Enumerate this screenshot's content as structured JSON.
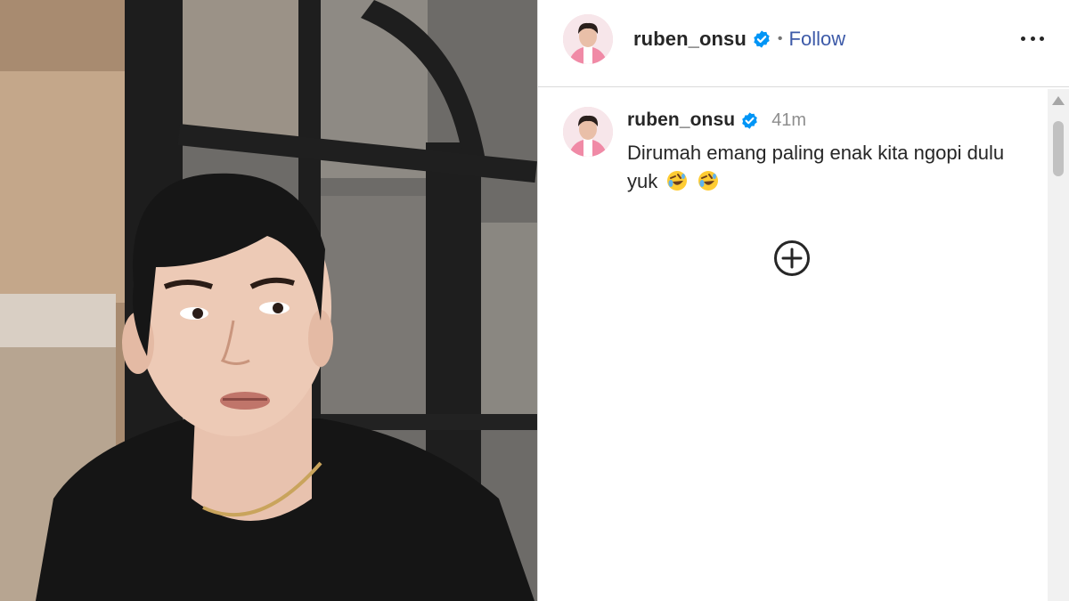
{
  "post": {
    "author": "ruben_onsu",
    "follow_label": "Follow",
    "separator": "•"
  },
  "comment": {
    "author": "ruben_onsu",
    "time": "41m",
    "text": "Dirumah emang paling enak kita ngopi dulu yuk"
  },
  "icons": {
    "verified": "verified-badge-icon",
    "more": "more-options-icon",
    "load_more": "plus-circle-icon",
    "emoji": "rolling-on-floor-laughing-emoji"
  },
  "colors": {
    "verified_blue": "#0095f6",
    "follow_link": "#3d5aa8",
    "muted": "#8e8e8e"
  }
}
